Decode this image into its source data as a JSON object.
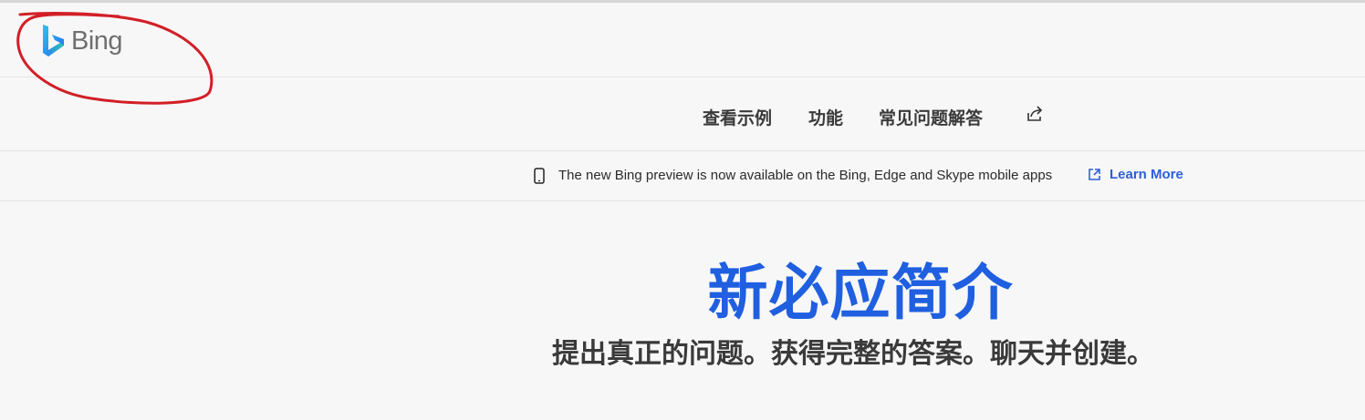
{
  "header": {
    "logo_text": "Bing",
    "logo_icon": "bing-b-icon"
  },
  "nav": {
    "items": [
      {
        "label": "查看示例"
      },
      {
        "label": "功能"
      },
      {
        "label": "常见问题解答"
      }
    ],
    "share_icon": "share-icon"
  },
  "banner": {
    "icon": "mobile-phone-icon",
    "text": "The new Bing preview is now available on the Bing, Edge and Skype mobile apps",
    "link_icon": "external-link-icon",
    "link_label": "Learn More"
  },
  "hero": {
    "title": "新必应简介",
    "subtitle": "提出真正的问题。获得完整的答案。聊天并创建。"
  },
  "colors": {
    "accent": "#1f5fe0",
    "link": "#2f5fd6",
    "annotation": "#d21f26",
    "background": "#f7f7f8"
  }
}
